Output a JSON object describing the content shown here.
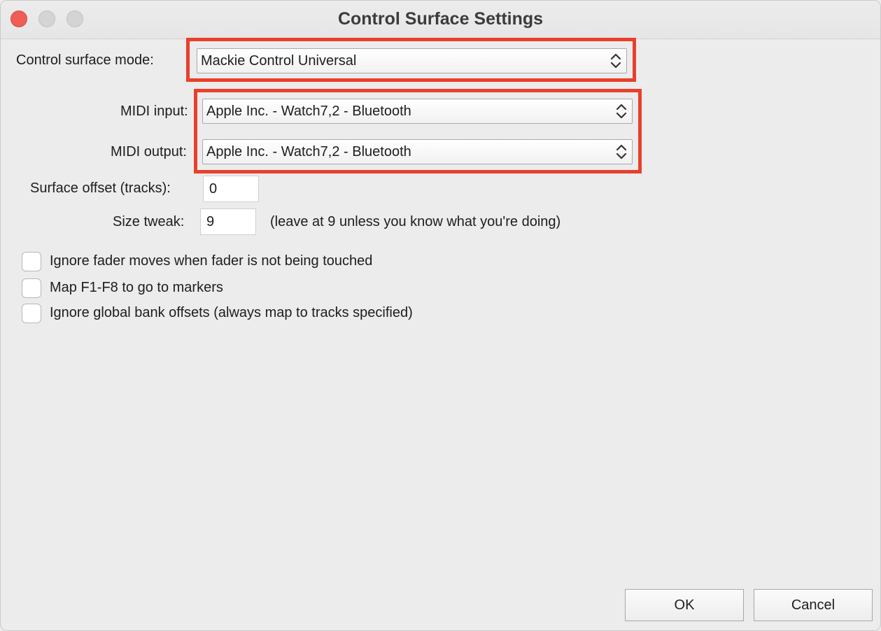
{
  "window": {
    "title": "Control Surface Settings"
  },
  "mode": {
    "label": "Control surface mode:",
    "value": "Mackie Control Universal"
  },
  "midi_input": {
    "label": "MIDI input:",
    "value": "Apple Inc. - Watch7,2 - Bluetooth"
  },
  "midi_output": {
    "label": "MIDI output:",
    "value": "Apple Inc. - Watch7,2 - Bluetooth"
  },
  "surface_offset": {
    "label": "Surface offset (tracks):",
    "value": "0"
  },
  "size_tweak": {
    "label": "Size tweak:",
    "value": "9",
    "hint": "(leave at 9 unless you know what you're doing)"
  },
  "options": [
    {
      "label": "Ignore fader moves when fader is not being touched",
      "checked": false
    },
    {
      "label": "Map F1-F8 to go to markers",
      "checked": false
    },
    {
      "label": "Ignore global bank offsets (always map to tracks specified)",
      "checked": false
    }
  ],
  "buttons": {
    "ok": "OK",
    "cancel": "Cancel"
  },
  "colors": {
    "highlight": "#e8402d",
    "close_button": "#ee5e56"
  },
  "icons": [
    "close-icon",
    "minimize-icon",
    "zoom-icon",
    "updown-chevron-icon"
  ]
}
